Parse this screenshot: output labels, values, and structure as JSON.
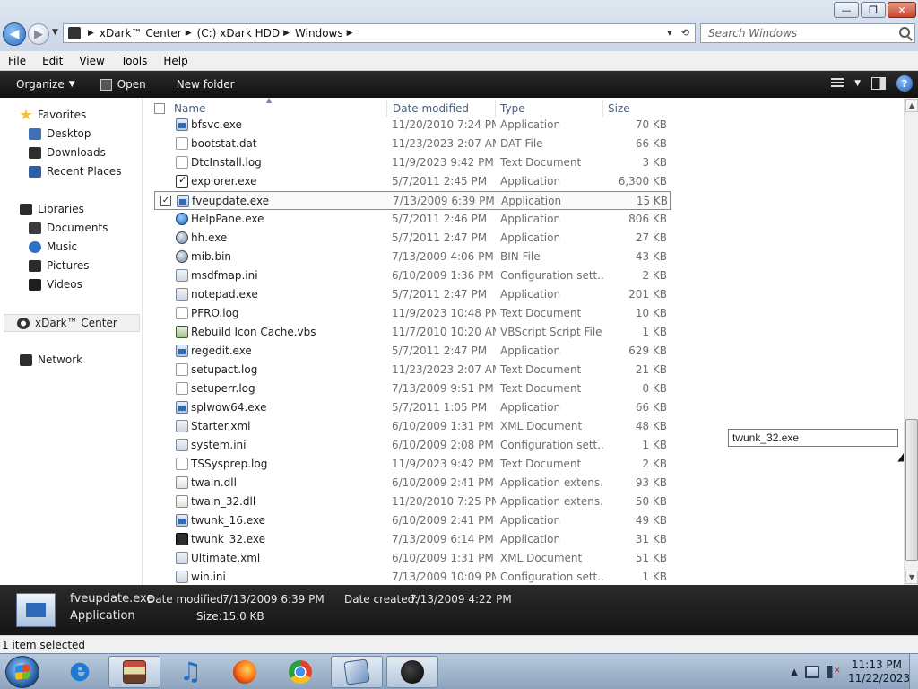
{
  "window": {
    "minimize_label": "—",
    "maximize_label": "❐",
    "close_label": "✕"
  },
  "address_bar": {
    "crumbs": [
      "xDark™ Center",
      "(C:) xDark HDD",
      "Windows"
    ],
    "dropdown_glyph": "▾",
    "refresh_glyph": "⟲"
  },
  "search": {
    "placeholder": "Search Windows"
  },
  "menu": [
    "File",
    "Edit",
    "View",
    "Tools",
    "Help"
  ],
  "toolbar": {
    "organize": "Organize",
    "open": "Open",
    "new_folder": "New folder",
    "help": "?"
  },
  "nav": {
    "favorites": "Favorites",
    "desktop": "Desktop",
    "downloads": "Downloads",
    "recent": "Recent Places",
    "libraries": "Libraries",
    "documents": "Documents",
    "music": "Music",
    "pictures": "Pictures",
    "videos": "Videos",
    "xdark": "xDark™ Center",
    "network": "Network"
  },
  "columns": {
    "name": "Name",
    "date": "Date modified",
    "type": "Type",
    "size": "Size"
  },
  "files": [
    {
      "name": "bfsvc.exe",
      "date": "11/20/2010 7:24 PM",
      "type": "Application",
      "size": "70 KB",
      "icon": "app"
    },
    {
      "name": "bootstat.dat",
      "date": "11/23/2023 2:07 AM",
      "type": "DAT File",
      "size": "66 KB",
      "icon": "doc"
    },
    {
      "name": "DtcInstall.log",
      "date": "11/9/2023 9:42 PM",
      "type": "Text Document",
      "size": "3 KB",
      "icon": "doc"
    },
    {
      "name": "explorer.exe",
      "date": "5/7/2011 2:45 PM",
      "type": "Application",
      "size": "6,300 KB",
      "icon": "check"
    },
    {
      "name": "fveupdate.exe",
      "date": "7/13/2009 6:39 PM",
      "type": "Application",
      "size": "15 KB",
      "icon": "app",
      "selected": true
    },
    {
      "name": "HelpPane.exe",
      "date": "5/7/2011 2:46 PM",
      "type": "Application",
      "size": "806 KB",
      "icon": "blue"
    },
    {
      "name": "hh.exe",
      "date": "5/7/2011 2:47 PM",
      "type": "Application",
      "size": "27 KB",
      "icon": "round"
    },
    {
      "name": "mib.bin",
      "date": "7/13/2009 4:06 PM",
      "type": "BIN File",
      "size": "43 KB",
      "icon": "round"
    },
    {
      "name": "msdfmap.ini",
      "date": "6/10/2009 1:36 PM",
      "type": "Configuration sett...",
      "size": "2 KB",
      "icon": "ini"
    },
    {
      "name": "notepad.exe",
      "date": "5/7/2011 2:47 PM",
      "type": "Application",
      "size": "201 KB",
      "icon": "ini"
    },
    {
      "name": "PFRO.log",
      "date": "11/9/2023 10:48 PM",
      "type": "Text Document",
      "size": "10 KB",
      "icon": "doc"
    },
    {
      "name": "Rebuild Icon Cache.vbs",
      "date": "11/7/2010 10:20 AM",
      "type": "VBScript Script File",
      "size": "1 KB",
      "icon": "script"
    },
    {
      "name": "regedit.exe",
      "date": "5/7/2011 2:47 PM",
      "type": "Application",
      "size": "629 KB",
      "icon": "app"
    },
    {
      "name": "setupact.log",
      "date": "11/23/2023 2:07 AM",
      "type": "Text Document",
      "size": "21 KB",
      "icon": "doc"
    },
    {
      "name": "setuperr.log",
      "date": "7/13/2009 9:51 PM",
      "type": "Text Document",
      "size": "0 KB",
      "icon": "doc"
    },
    {
      "name": "splwow64.exe",
      "date": "5/7/2011 1:05 PM",
      "type": "Application",
      "size": "66 KB",
      "icon": "app"
    },
    {
      "name": "Starter.xml",
      "date": "6/10/2009 1:31 PM",
      "type": "XML Document",
      "size": "48 KB",
      "icon": "ini"
    },
    {
      "name": "system.ini",
      "date": "6/10/2009 2:08 PM",
      "type": "Configuration sett...",
      "size": "1 KB",
      "icon": "ini"
    },
    {
      "name": "TSSysprep.log",
      "date": "11/9/2023 9:42 PM",
      "type": "Text Document",
      "size": "2 KB",
      "icon": "doc"
    },
    {
      "name": "twain.dll",
      "date": "6/10/2009 2:41 PM",
      "type": "Application extens...",
      "size": "93 KB",
      "icon": "dll"
    },
    {
      "name": "twain_32.dll",
      "date": "11/20/2010 7:25 PM",
      "type": "Application extens...",
      "size": "50 KB",
      "icon": "dll"
    },
    {
      "name": "twunk_16.exe",
      "date": "6/10/2009 2:41 PM",
      "type": "Application",
      "size": "49 KB",
      "icon": "app"
    },
    {
      "name": "twunk_32.exe",
      "date": "7/13/2009 6:14 PM",
      "type": "Application",
      "size": "31 KB",
      "icon": "dark"
    },
    {
      "name": "Ultimate.xml",
      "date": "6/10/2009 1:31 PM",
      "type": "XML Document",
      "size": "51 KB",
      "icon": "ini"
    },
    {
      "name": "win.ini",
      "date": "7/13/2009 10:09 PM",
      "type": "Configuration sett...",
      "size": "1 KB",
      "icon": "ini"
    }
  ],
  "rename_value": "twunk_32.exe",
  "details": {
    "filename": "fveupdate.exe",
    "filetype": "Application",
    "modified_label": "Date modified:",
    "modified_value": "7/13/2009 6:39 PM",
    "size_label": "Size:",
    "size_value": "15.0 KB",
    "created_label": "Date created:",
    "created_value": "7/13/2009 4:22 PM"
  },
  "status": "1 item selected",
  "taskbar": {
    "tray_arrow": "▲",
    "time": "11:13 PM",
    "date": "11/22/2023"
  }
}
